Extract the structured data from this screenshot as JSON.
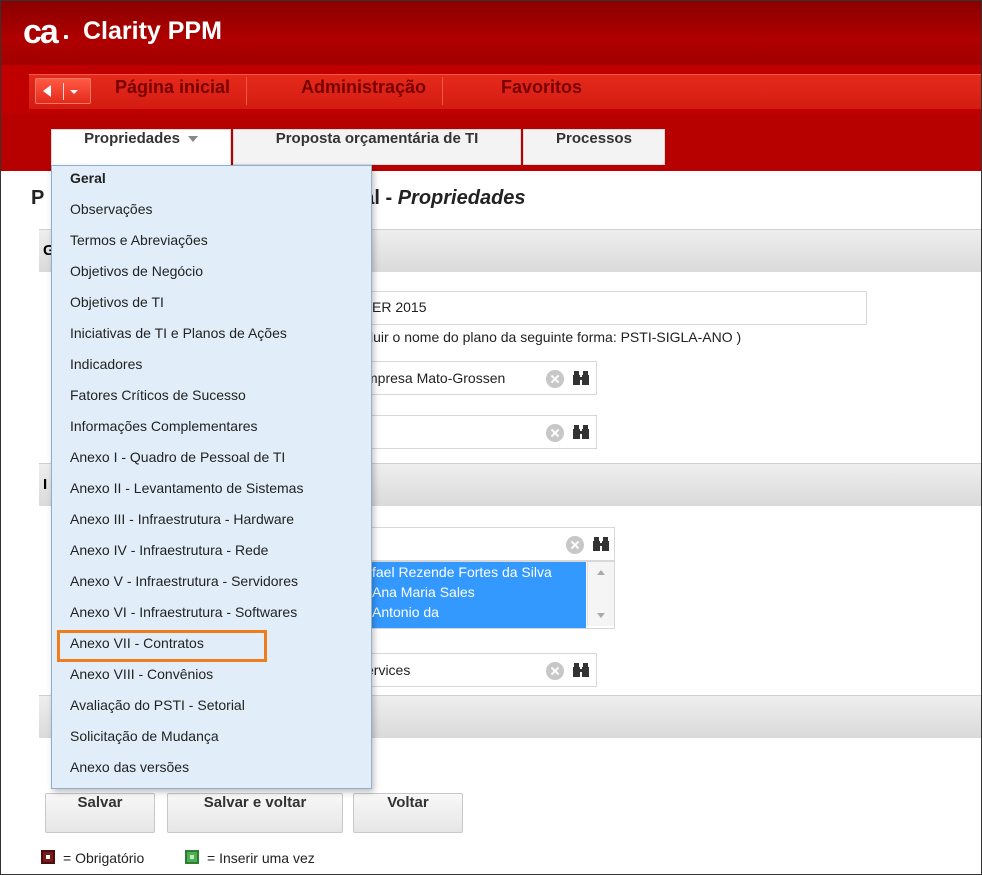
{
  "app": {
    "logo": "ca",
    "title": "Clarity PPM"
  },
  "nav": {
    "items": [
      "Página inicial",
      "Administração",
      "Favoritos"
    ]
  },
  "tabs": [
    {
      "label": "Propriedades",
      "active": true
    },
    {
      "label": "Proposta orçamentária de TI"
    },
    {
      "label": "Processos"
    }
  ],
  "page": {
    "title_prefix_letter": "P",
    "title_fragment": "eral - ",
    "title_italic": "Propriedades"
  },
  "form": {
    "section1_letter": "G",
    "section2_letter": "I",
    "plan_name_value": "ER 2015",
    "plan_name_hint": "cluir o nome do plano da seguinte forma: PSTI-SIGLA-ANO )",
    "organization_value": "mpresa Mato-Grossen",
    "lookup2_value": "",
    "lookup3_value": "",
    "members": [
      "fael Rezende Fortes da Silva",
      "Ana Maria Sales",
      "Antonio da"
    ],
    "services_value": "ervices"
  },
  "menu": {
    "items": [
      "Geral",
      "Observações",
      "Termos e Abreviações",
      "Objetivos de Negócio",
      "Objetivos de TI",
      "Iniciativas de TI e Planos de Ações",
      "Indicadores",
      "Fatores Críticos de Sucesso",
      "Informações Complementares",
      "Anexo I - Quadro de Pessoal de TI",
      "Anexo II - Levantamento de Sistemas",
      "Anexo III - Infraestrutura - Hardware",
      "Anexo IV - Infraestrutura - Rede",
      "Anexo V - Infraestrutura - Servidores",
      "Anexo VI - Infraestrutura - Softwares",
      "Anexo VII - Contratos",
      "Anexo VIII - Convênios",
      "Avaliação do PSTI - Setorial",
      "Solicitação de Mudança",
      "Anexo das versões"
    ],
    "highlighted": "Anexo VII - Contratos"
  },
  "buttons": {
    "save": "Salvar",
    "save_back": "Salvar e voltar",
    "back": "Voltar"
  },
  "legend": {
    "required": "= Obrigatório",
    "once": "= Inserir uma vez"
  },
  "colors": {
    "header": "#b00000",
    "nav": "#e52a1b",
    "menu_bg": "#e1eef9",
    "highlight": "#f07d1b",
    "selection": "#3399ff"
  }
}
